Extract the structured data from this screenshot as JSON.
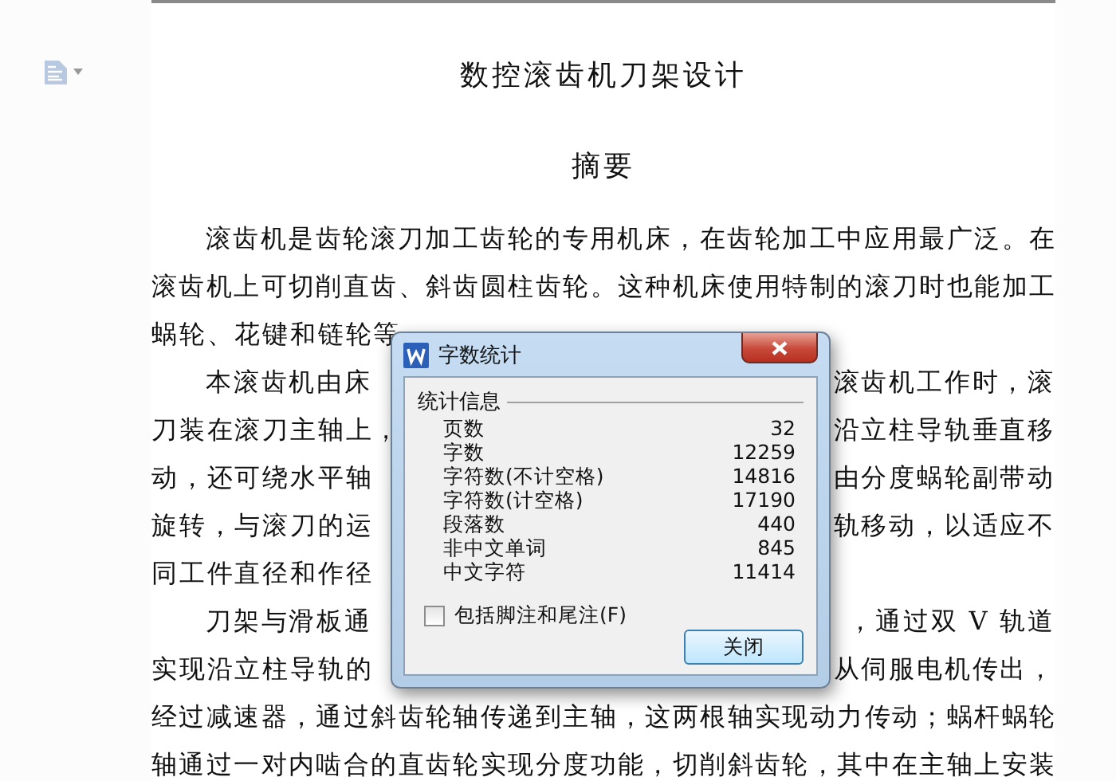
{
  "document": {
    "title": "数控滚齿机刀架设计",
    "heading": "摘要",
    "lines": [
      {
        "indent": true,
        "text": "滚齿机是齿轮滚刀加工齿轮的专用机床，在齿轮加工中应用最广泛。在"
      },
      {
        "indent": false,
        "text": "滚齿机上可切削直齿、斜齿圆柱齿轮。这种机床使用特制的滚刀时也能加工"
      },
      {
        "indent": false,
        "left": "蜗轮、花键和链轮等"
      },
      {
        "indent": true,
        "left": "本滚齿机由床",
        "right": "滚齿机工作时，滚"
      },
      {
        "indent": false,
        "left": "刀装在滚刀主轴上，",
        "right": "沿立柱导轨垂直移"
      },
      {
        "indent": false,
        "left": "动，还可绕水平轴",
        "right": "由分度蜗轮副带动"
      },
      {
        "indent": false,
        "left": "旋转，与滚刀的运",
        "right": "轨移动，以适应不"
      },
      {
        "indent": false,
        "left": "同工件直径和作径"
      },
      {
        "indent": true,
        "left": "刀架与滑板通",
        "right": "，通过双 V 轨道"
      },
      {
        "indent": false,
        "left": "实现沿立柱导轨的",
        "right": "从伺服电机传出，"
      },
      {
        "indent": false,
        "text": "经过减速器，通过斜齿轮轴传递到主轴，这两根轴实现动力传动；蜗杆蜗轮"
      },
      {
        "indent": false,
        "text": "轴通过一对内啮合的直齿轮实现分度功能，切削斜齿轮，其中在主轴上安装"
      }
    ]
  },
  "dialog": {
    "title": "字数统计",
    "group": "统计信息",
    "stats": [
      {
        "label": "页数",
        "value": "32"
      },
      {
        "label": "字数",
        "value": "12259"
      },
      {
        "label": "字符数(不计空格)",
        "value": "14816"
      },
      {
        "label": "字符数(计空格)",
        "value": "17190"
      },
      {
        "label": "段落数",
        "value": "440"
      },
      {
        "label": "非中文单词",
        "value": "845"
      },
      {
        "label": "中文字符",
        "value": "11414"
      }
    ],
    "checkbox": {
      "label": "包括脚注和尾注(F)",
      "checked": false
    },
    "close_button": "关闭"
  }
}
